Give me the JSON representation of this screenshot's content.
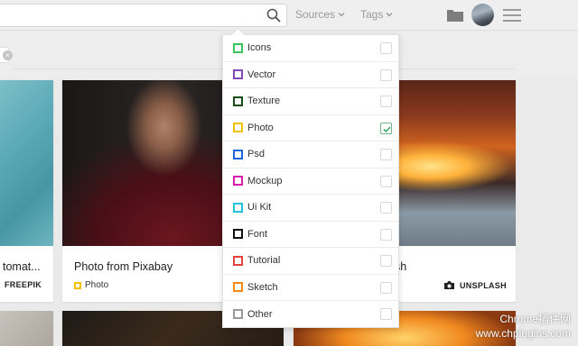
{
  "search": {
    "value": "",
    "placeholder": ""
  },
  "nav": {
    "sources_label": "Sources",
    "tags_label": "Tags"
  },
  "icons": {
    "search": "search-icon",
    "folder": "folder-icon",
    "menu": "hamburger-menu-icon",
    "chevron": "chevron-down-icon",
    "camera": "camera-icon"
  },
  "filter_chip": {
    "remove_label": "×"
  },
  "cards": [
    {
      "title": "tomat...",
      "source": "FREEPIK"
    },
    {
      "title": "Photo from Pixabay",
      "tag": "Photo"
    },
    {
      "title": "sh",
      "source": "UNSPLASH"
    }
  ],
  "tags_dropdown": {
    "items": [
      {
        "label": "Icons",
        "color": "#3ac45b",
        "checked": false
      },
      {
        "label": "Vector",
        "color": "#8447b8",
        "checked": false
      },
      {
        "label": "Texture",
        "color": "#1b4d1b",
        "checked": false
      },
      {
        "label": "Photo",
        "color": "#f2c200",
        "checked": true
      },
      {
        "label": "Psd",
        "color": "#1f64e0",
        "checked": false
      },
      {
        "label": "Mockup",
        "color": "#d81eaa",
        "checked": false
      },
      {
        "label": "Ui Kit",
        "color": "#22c3d6",
        "checked": false
      },
      {
        "label": "Font",
        "color": "#111111",
        "checked": false
      },
      {
        "label": "Tutorial",
        "color": "#e3443f",
        "checked": false
      },
      {
        "label": "Sketch",
        "color": "#f28c14",
        "checked": false
      },
      {
        "label": "Other",
        "color": "#9a9a9a",
        "checked": false
      }
    ]
  },
  "watermark": {
    "line1": "Chrome插件网",
    "line2": "www.chplugins.com"
  }
}
